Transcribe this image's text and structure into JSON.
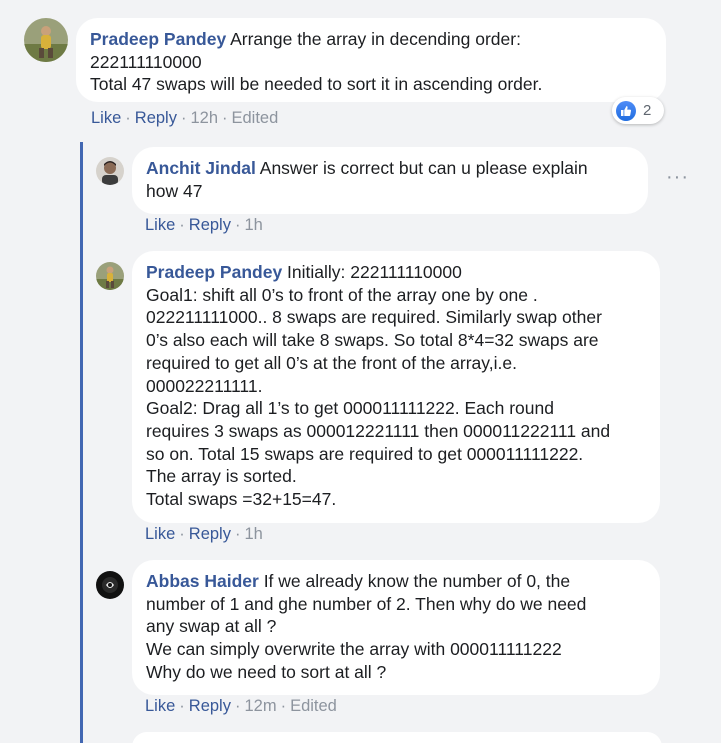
{
  "comments": [
    {
      "author": "Pradeep Pandey",
      "lines": [
        "Arrange the array in decending order:",
        "222111110000",
        "Total 47 swaps will be needed to sort it in ascending order."
      ],
      "actions": {
        "like": "Like",
        "reply": "Reply",
        "time": "12h",
        "edited": "Edited"
      },
      "reactions": {
        "count": "2"
      }
    },
    {
      "author": "Anchit Jindal",
      "lines": [
        "Answer is correct but can u please explain",
        "how 47"
      ],
      "actions": {
        "like": "Like",
        "reply": "Reply",
        "time": "1h"
      }
    },
    {
      "author": "Pradeep Pandey",
      "lines": [
        "Initially: 222111110000",
        "Goal1: shift all 0’s to front of the array one by one .",
        "022211111000.. 8 swaps are required. Similarly swap other",
        "0’s also each will take 8 swaps. So total 8*4=32 swaps are",
        "required to get all 0’s at the front of the array,i.e.",
        "000022211111.",
        "Goal2: Drag all 1’s to get 000011111222. Each round",
        "requires 3 swaps as 000012221111 then 000011222111 and",
        "so on. Total 15 swaps are required to get 000011111222.",
        "The array is sorted.",
        "Total swaps =32+15=47."
      ],
      "actions": {
        "like": "Like",
        "reply": "Reply",
        "time": "1h"
      }
    },
    {
      "author": "Abbas Haider",
      "lines": [
        "If we already know the number of 0, the",
        "number of 1 and ghe number of 2. Then why do we need",
        "any swap at all ?",
        "We can simply overwrite the array with 000011111222",
        "Why do we need to sort at all ?"
      ],
      "actions": {
        "like": "Like",
        "reply": "Reply",
        "time": "12m",
        "edited": "Edited"
      }
    }
  ],
  "colors": {
    "background": "#f2f3f5",
    "author": "#385898",
    "link": "#385898",
    "meta": "#8d949e",
    "thread_line": "#4267b2",
    "like_reaction": "#1f6de0"
  },
  "icons": {
    "reaction": "like-thumb-icon",
    "more": "more-options-icon"
  }
}
